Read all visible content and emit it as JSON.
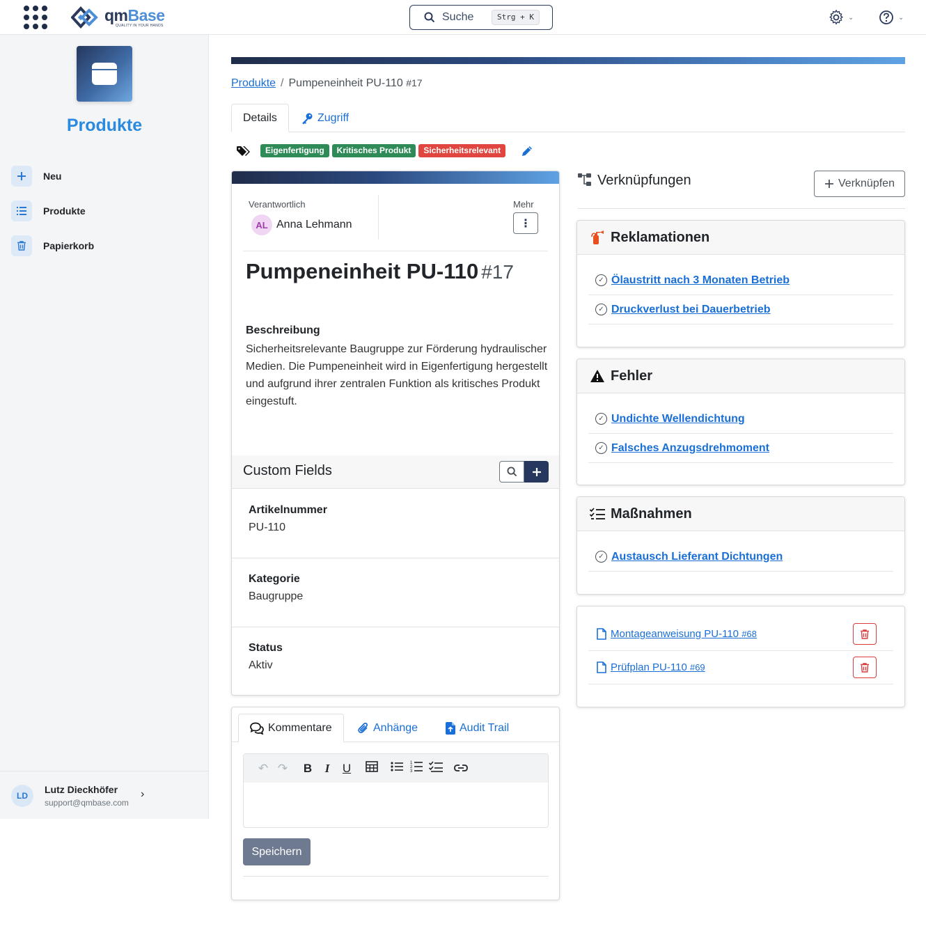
{
  "topbar": {
    "logo_brand_q": "qm",
    "logo_brand_b": "Base",
    "logo_tagline": "QUALITY IN YOUR HANDS",
    "search_label": "Suche",
    "search_shortcut": "Strg + K",
    "icons": [
      "apps-grid-icon",
      "gear-icon",
      "help-icon"
    ]
  },
  "sidebar": {
    "module_title": "Produkte",
    "items": [
      {
        "label": "Neu",
        "icon": "plus-icon"
      },
      {
        "label": "Produkte",
        "icon": "list-icon"
      },
      {
        "label": "Papierkorb",
        "icon": "trash-icon"
      }
    ],
    "user": {
      "initials": "LD",
      "name": "Lutz Dieckhöfer",
      "email": "support@qmbase.com"
    }
  },
  "breadcrumb": {
    "parent": "Produkte",
    "separator": "/",
    "current": "Pumpeneinheit PU-110",
    "current_num": "#17"
  },
  "tabs": {
    "details": "Details",
    "access": "Zugriff"
  },
  "tags": [
    {
      "label": "Eigenfertigung",
      "color": "#2e8b57"
    },
    {
      "label": "Kritisches Produkt",
      "color": "#2e8b57"
    },
    {
      "label": "Sicherheitsrelevant",
      "color": "#e0463f"
    }
  ],
  "detail": {
    "responsible_label": "Verantwortlich",
    "responsible_initials": "AL",
    "responsible_name": "Anna Lehmann",
    "more_label": "Mehr",
    "title": "Pumpeneinheit PU-110",
    "number": "#17",
    "description_heading": "Beschreibung",
    "description": "Sicherheitsrelevante Baugruppe zur Förderung hydraulischer Medien. Die Pumpeneinheit wird in Eigenfertigung hergestellt und aufgrund ihrer zentralen Funktion als kritisches Produkt eingestuft.",
    "custom_fields_title": "Custom Fields",
    "custom_fields": [
      {
        "key": "Artikelnummer",
        "value": "PU-110"
      },
      {
        "key": "Kategorie",
        "value": "Baugruppe"
      },
      {
        "key": "Status",
        "value": "Aktiv"
      }
    ]
  },
  "comments": {
    "tabs": [
      "Kommentare",
      "Anhänge",
      "Audit Trail"
    ],
    "save_label": "Speichern"
  },
  "links": {
    "title": "Verknüpfungen",
    "link_button": "Verknüpfen",
    "complaints": {
      "title": "Reklamationen",
      "items": [
        "Ölaustritt nach 3 Monaten Betrieb",
        "Druckverlust bei Dauerbetrieb"
      ]
    },
    "errors": {
      "title": "Fehler",
      "items": [
        "Undichte Wellendichtung",
        "Falsches Anzugsdrehmoment"
      ]
    },
    "actions": {
      "title": "Maßnahmen",
      "items": [
        "Austausch Lieferant Dichtungen"
      ]
    },
    "documents": [
      {
        "name": "Montageanweisung PU-110",
        "num": "#68"
      },
      {
        "name": "Prüfplan PU-110",
        "num": "#69"
      }
    ]
  },
  "colors": {
    "accent": "#1a6fd6",
    "navy": "#26385e",
    "module_title": "#2a8ae0"
  }
}
